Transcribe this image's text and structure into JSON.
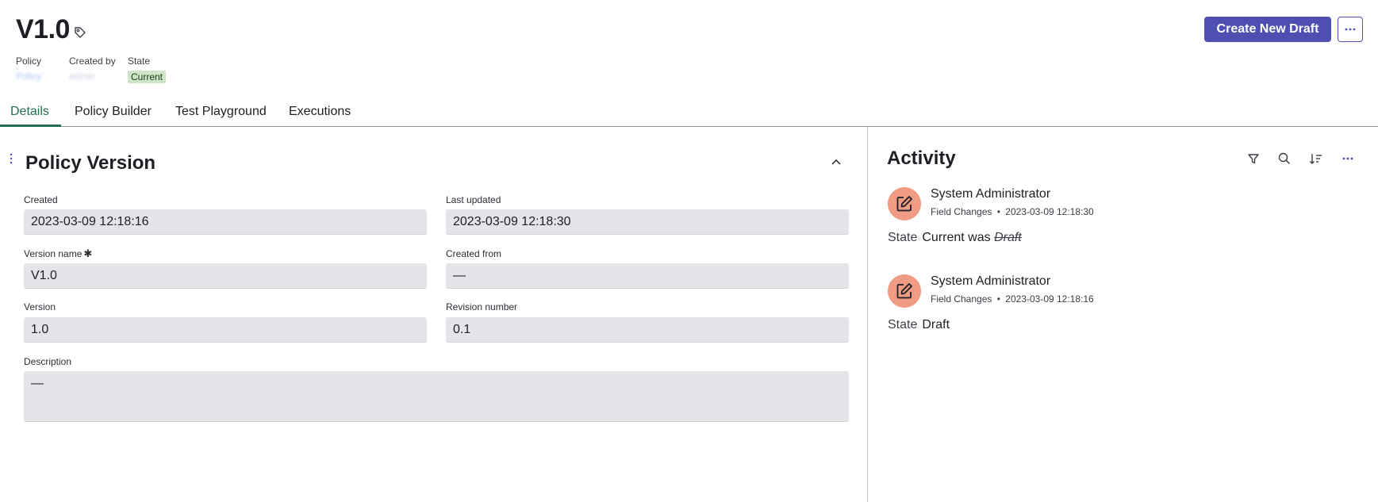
{
  "header": {
    "title": "V1.0",
    "meta": {
      "policy_label": "Policy",
      "policy_value": "Policy",
      "created_by_label": "Created by",
      "created_by_value": "admin",
      "state_label": "State",
      "state_value": "Current"
    },
    "create_button": "Create New Draft",
    "more_icon": "ellipsis-icon"
  },
  "tabs": [
    {
      "label": "Details",
      "active": true
    },
    {
      "label": "Policy Builder",
      "active": false
    },
    {
      "label": "Test Playground",
      "active": false
    },
    {
      "label": "Executions",
      "active": false
    }
  ],
  "section": {
    "title": "Policy Version",
    "fields": {
      "created": {
        "label": "Created",
        "value": "2023-03-09 12:18:16"
      },
      "last_updated": {
        "label": "Last updated",
        "value": "2023-03-09 12:18:30"
      },
      "version_name": {
        "label": "Version name",
        "required_mark": "✱",
        "value": "V1.0"
      },
      "created_from": {
        "label": "Created from",
        "value": "—"
      },
      "version": {
        "label": "Version",
        "value": "1.0"
      },
      "revision_number": {
        "label": "Revision number",
        "value": "0.1"
      },
      "description": {
        "label": "Description",
        "value": "—"
      }
    }
  },
  "activity": {
    "title": "Activity",
    "toolbar_icons": [
      "filter-icon",
      "search-icon",
      "sort-icon",
      "ellipsis-icon"
    ],
    "entries": [
      {
        "user": "System Administrator",
        "type": "Field Changes",
        "separator": "•",
        "timestamp": "2023-03-09 12:18:30",
        "field": "State",
        "new_value": "Current",
        "was_text": "was",
        "old_value": "Draft"
      },
      {
        "user": "System Administrator",
        "type": "Field Changes",
        "separator": "•",
        "timestamp": "2023-03-09 12:18:16",
        "field": "State",
        "new_value": "Draft"
      }
    ]
  },
  "colors": {
    "primary": "#4d50b0",
    "active_tab": "#22704f",
    "badge_bg": "#cfe5c8",
    "avatar_bg": "#f09b83",
    "field_bg": "#e4e5e8"
  }
}
